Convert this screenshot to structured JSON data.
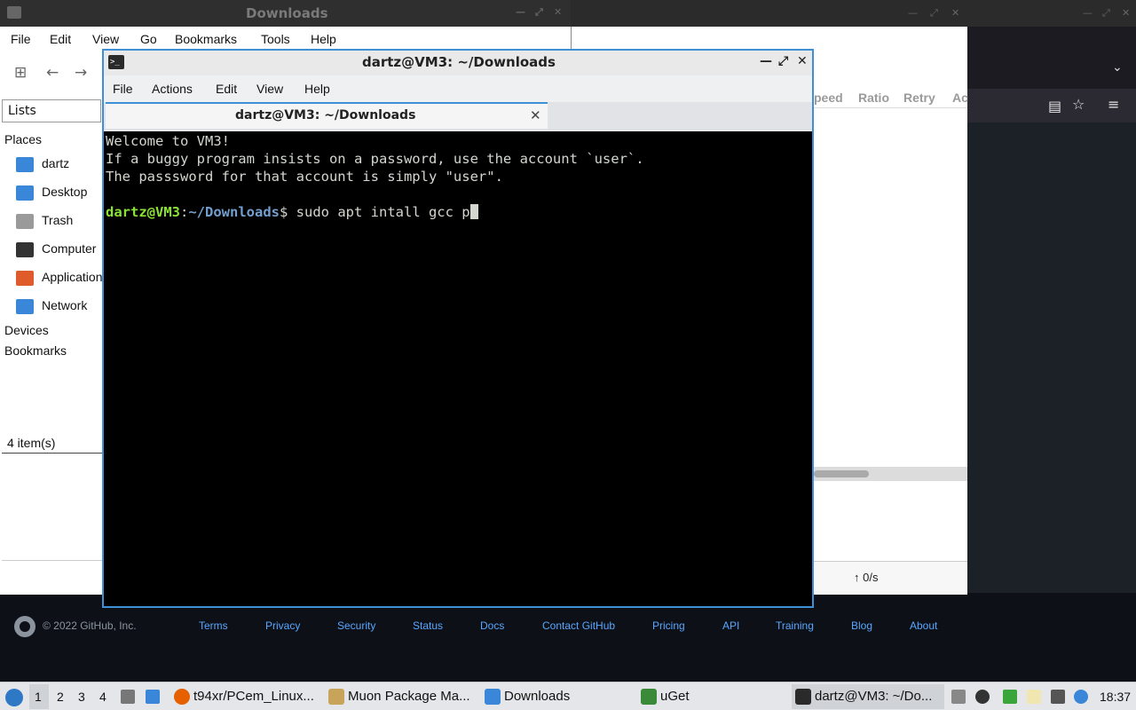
{
  "file_manager": {
    "title": "Downloads",
    "menu": [
      "File",
      "Edit",
      "View",
      "Go",
      "Bookmarks",
      "Tools",
      "Help"
    ],
    "lists_label": "Lists",
    "places_header": "Places",
    "places": [
      {
        "label": "dartz",
        "icon": "home-folder-icon",
        "color": "#3a86d9"
      },
      {
        "label": "Desktop",
        "icon": "desktop-icon",
        "color": "#3a86d9"
      },
      {
        "label": "Trash",
        "icon": "trash-icon",
        "color": "#9a9a9a"
      },
      {
        "label": "Computer",
        "icon": "computer-icon",
        "color": "#333333"
      },
      {
        "label": "Applications",
        "icon": "applications-icon",
        "color": "#e05b2b"
      },
      {
        "label": "Network",
        "icon": "network-icon",
        "color": "#3a86d9"
      }
    ],
    "devices_header": "Devices",
    "bookmarks_header": "Bookmarks",
    "status": "4 item(s)"
  },
  "uget": {
    "columns": [
      "peed",
      "Ratio",
      "Retry",
      "Ac"
    ],
    "upload_speed": "↑ 0/s"
  },
  "terminal": {
    "window_title": "dartz@VM3: ~/Downloads",
    "menu": [
      "File",
      "Actions",
      "Edit",
      "View",
      "Help"
    ],
    "tab_title": "dartz@VM3: ~/Downloads",
    "lines": [
      "Welcome to VM3!",
      "If a buggy program insists on a password, use the account `user`.",
      "The passsword for that account is simply \"user\"."
    ],
    "prompt_user": "dartz@VM3",
    "prompt_sep": ":",
    "prompt_path": "~/Downloads",
    "prompt_symbol": "$ ",
    "command": "sudo apt intall gcc p",
    "colors": {
      "user": "#8ae234",
      "path": "#729fcf",
      "text": "#d3d7cf",
      "accent": "#3d8fd6"
    }
  },
  "github_footer": {
    "copyright": "© 2022 GitHub, Inc.",
    "links": [
      "Terms",
      "Privacy",
      "Security",
      "Status",
      "Docs",
      "Contact GitHub",
      "Pricing",
      "API",
      "Training",
      "Blog",
      "About"
    ]
  },
  "taskbar": {
    "workspaces": [
      "1",
      "2",
      "3",
      "4"
    ],
    "tasks": [
      {
        "label": "t94xr/PCem_Linux...",
        "icon": "firefox-icon",
        "color": "#e66000"
      },
      {
        "label": "Muon Package Ma...",
        "icon": "package-manager-icon",
        "color": "#c8a45a"
      },
      {
        "label": "Downloads",
        "icon": "folder-icon",
        "color": "#3a86d9"
      },
      {
        "label": "uGet",
        "icon": "uget-icon",
        "color": "#3a8a3a"
      },
      {
        "label": "dartz@VM3: ~/Do...",
        "icon": "terminal-icon",
        "color": "#2a2a2a"
      }
    ],
    "clock": "18:37"
  }
}
